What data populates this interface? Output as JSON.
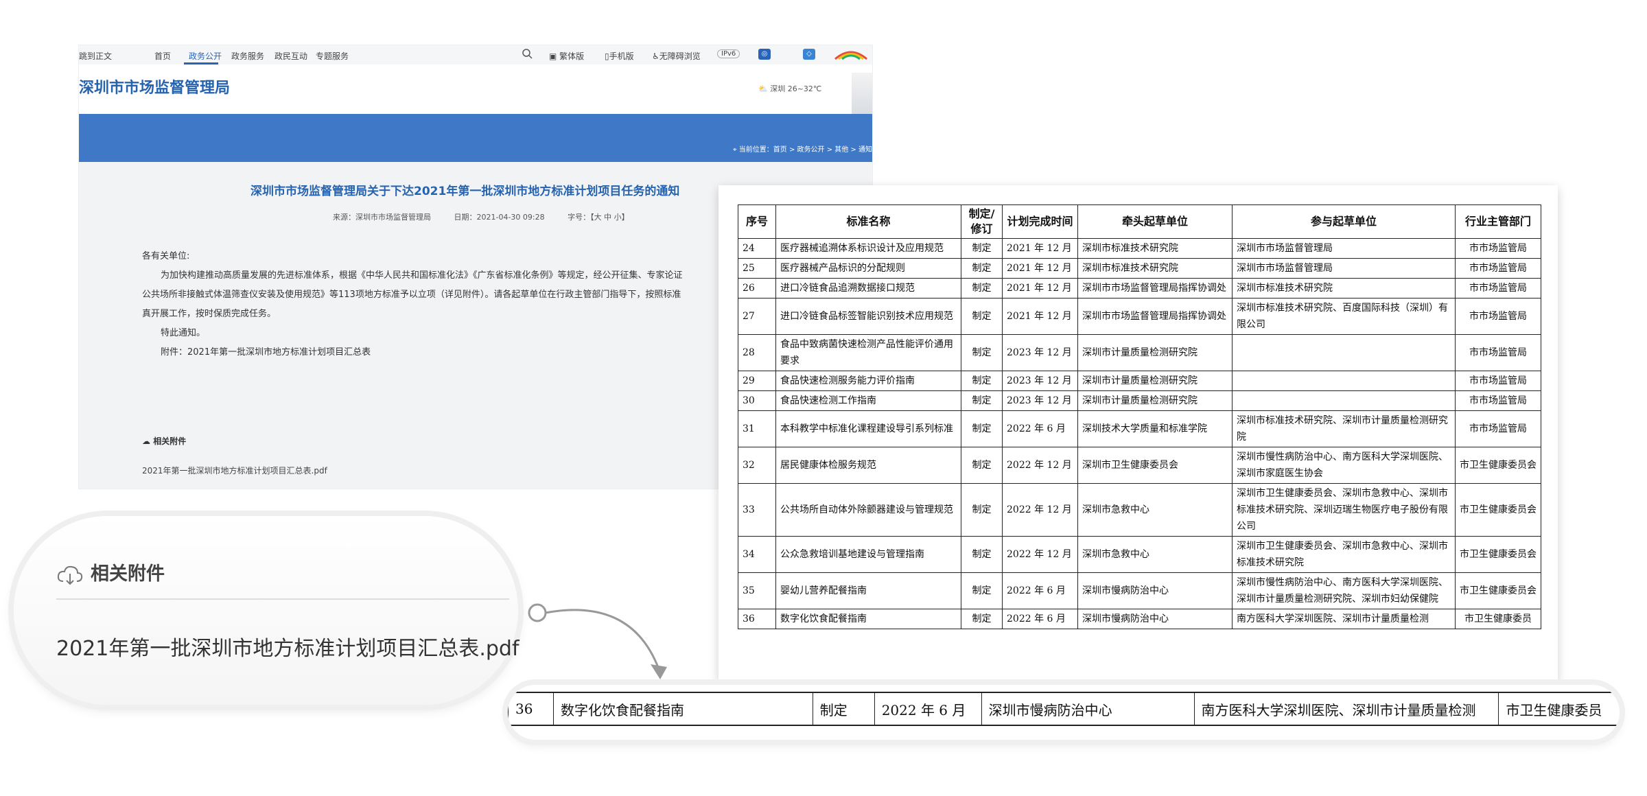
{
  "nav": {
    "items": [
      "跳到正文",
      "首页",
      "政务公开",
      "政务服务",
      "政民互动",
      "专题服务"
    ],
    "active_index": 2,
    "tools": [
      "繁体版",
      "手机版",
      "无障碍浏览",
      "IPv6"
    ]
  },
  "site": {
    "title": "深圳市市场监督管理局",
    "weather": "深圳 26~32℃",
    "breadcrumb": "当前位置：首页 > 政务公开 > 其他 > 通知"
  },
  "article": {
    "title": "深圳市市场监督管理局关于下达2021年第一批深圳市地方标准计划项目任务的通知",
    "source": "来源：深圳市市场监督管理局",
    "date": "日期：2021-04-30 09:28",
    "fontsize": "字号：【大  中  小】",
    "salutation": "各有关单位:",
    "para1": "为加快构建推动高质量发展的先进标准体系，根据《中华人民共和国标准化法》《广东省标准化条例》等规定，经公开征集、专家论证",
    "para2": "公共场所非接触式体温筛查仪安装及使用规范》等113项地方标准予以立项（详见附件）。请各起草单位在行政主管部门指导下，按照标准",
    "para3": "真开展工作，按时保质完成任务。",
    "notice": "特此通知。",
    "attachment_line": "附件：2021年第一批深圳市地方标准计划项目汇总表",
    "related_heading": "相关附件",
    "file": "2021年第一批深圳市地方标准计划项目汇总表.pdf"
  },
  "callout": {
    "heading": "相关附件",
    "file": "2021年第一批深圳市地方标准计划项目汇总表.pdf"
  },
  "table": {
    "headers": [
      "序号",
      "标准名称",
      "制定/修订",
      "计划完成时间",
      "牵头起草单位",
      "参与起草单位",
      "行业主管部门"
    ],
    "rows": [
      [
        "24",
        "医疗器械追溯体系标识设计及应用规范",
        "制定",
        "2021 年 12 月",
        "深圳市标准技术研究院",
        "深圳市市场监督管理局",
        "市市场监管局"
      ],
      [
        "25",
        "医疗器械产品标识的分配规则",
        "制定",
        "2021 年 12 月",
        "深圳市标准技术研究院",
        "深圳市市场监督管理局",
        "市市场监管局"
      ],
      [
        "26",
        "进口冷链食品追溯数据接口规范",
        "制定",
        "2021 年 12 月",
        "深圳市市场监督管理局指挥协调处",
        "深圳市标准技术研究院",
        "市市场监管局"
      ],
      [
        "27",
        "进口冷链食品标签智能识别技术应用规范",
        "制定",
        "2021 年 12 月",
        "深圳市市场监督管理局指挥协调处",
        "深圳市标准技术研究院、百度国际科技（深圳）有限公司",
        "市市场监管局"
      ],
      [
        "28",
        "食品中致病菌快速检测产品性能评价通用要求",
        "制定",
        "2023 年 12 月",
        "深圳市计量质量检测研究院",
        "",
        "市市场监管局"
      ],
      [
        "29",
        "食品快速检测服务能力评价指南",
        "制定",
        "2023 年 12 月",
        "深圳市计量质量检测研究院",
        "",
        "市市场监管局"
      ],
      [
        "30",
        "食品快速检测工作指南",
        "制定",
        "2023 年 12 月",
        "深圳市计量质量检测研究院",
        "",
        "市市场监管局"
      ],
      [
        "31",
        "本科教学中标准化课程建设导引系列标准",
        "制定",
        "2022 年 6 月",
        "深圳技术大学质量和标准学院",
        "深圳市标准技术研究院、深圳市计量质量检测研究院",
        "市市场监管局"
      ],
      [
        "32",
        "居民健康体检服务规范",
        "制定",
        "2022 年 12 月",
        "深圳市卫生健康委员会",
        "深圳市慢性病防治中心、南方医科大学深圳医院、深圳市家庭医生协会",
        "市卫生健康委员会"
      ],
      [
        "33",
        "公共场所自动体外除颤器建设与管理规范",
        "制定",
        "2022 年 12 月",
        "深圳市急救中心",
        "深圳市卫生健康委员会、深圳市急救中心、深圳市标准技术研究院、深圳迈瑞生物医疗电子股份有限公司",
        "市卫生健康委员会"
      ],
      [
        "34",
        "公众急救培训基地建设与管理指南",
        "制定",
        "2022 年 12 月",
        "深圳市急救中心",
        "深圳市卫生健康委员会、深圳市急救中心、深圳市标准技术研究院",
        "市卫生健康委员会"
      ],
      [
        "35",
        "婴幼儿营养配餐指南",
        "制定",
        "2022 年 6 月",
        "深圳市慢病防治中心",
        "深圳市慢性病防治中心、南方医科大学深圳医院、深圳市计量质量检测研究院、深圳市妇幼保健院",
        "市卫生健康委员会"
      ],
      [
        "36",
        "数字化饮食配餐指南",
        "制定",
        "2022 年 6 月",
        "深圳市慢病防治中心",
        "南方医科大学深圳医院、深圳市计量质量检测",
        "市卫生健康委员"
      ]
    ]
  },
  "zoom_row": [
    "36",
    "数字化饮食配餐指南",
    "制定",
    "2022 年 6 月",
    "深圳市慢病防治中心",
    "南方医科大学深圳医院、深圳市计量质量检测",
    "市卫生健康委员"
  ]
}
